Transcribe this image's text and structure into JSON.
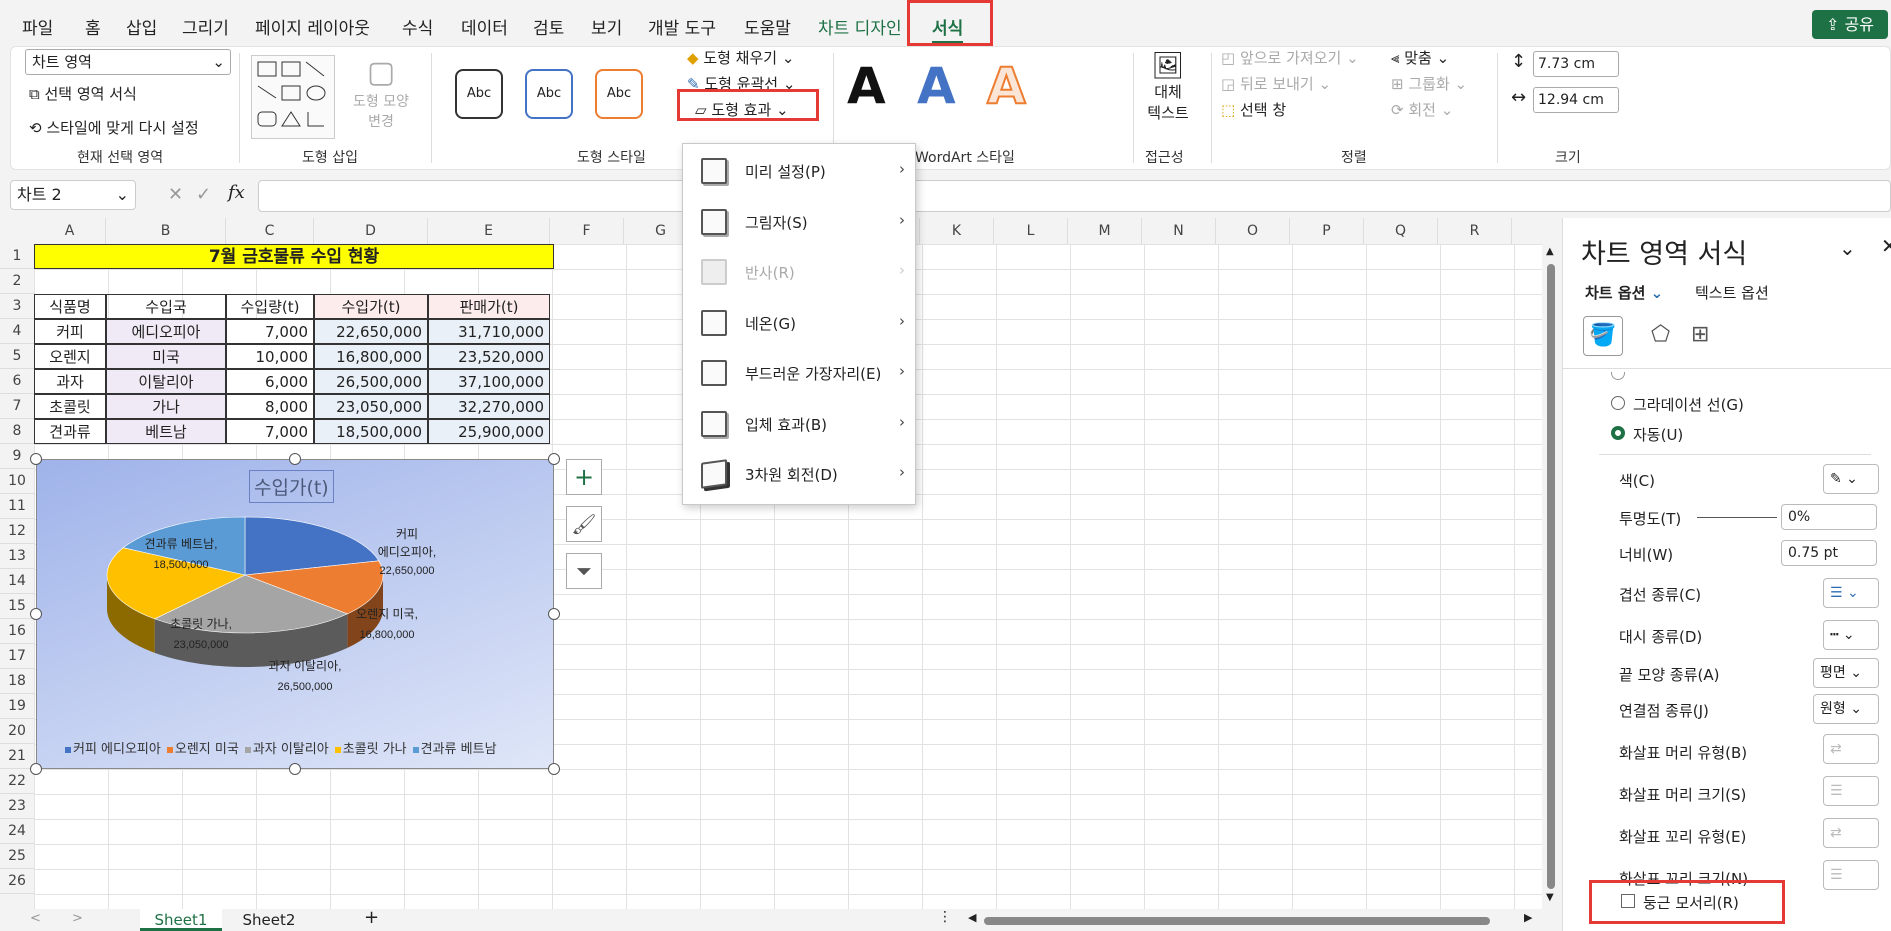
{
  "menu": [
    "파일",
    "홈",
    "삽입",
    "그리기",
    "페이지 레이아웃",
    "수식",
    "데이터",
    "검토",
    "보기",
    "개발 도구",
    "도움말",
    "차트 디자인",
    "서식"
  ],
  "share": "공유",
  "ribbon": {
    "selection_dropdown": "차트 영역",
    "format_selection": "선택 영역 서식",
    "reset_style": "스타일에 맞게 다시 설정",
    "grp_current": "현재 선택 영역",
    "change_shape": "도형 모양 변경",
    "grp_insert": "도형 삽입",
    "abc": "Abc",
    "shape_fill": "도형 채우기",
    "shape_outline": "도형 윤곽선",
    "shape_effects": "도형 효과",
    "grp_style": "도형 스타일",
    "wordart_letter": "A",
    "grp_wordart": "WordArt 스타일",
    "alt_text": "대체 텍스트",
    "grp_access": "접근성",
    "bring_forward": "앞으로 가져오기",
    "send_backward": "뒤로 보내기",
    "selection_pane": "선택 창",
    "align": "맞춤",
    "group": "그룹화",
    "rotate": "회전",
    "grp_arrange": "정렬",
    "height": "7.73 cm",
    "width": "12.94 cm",
    "grp_size": "크기"
  },
  "formula": {
    "namebox": "차트 2",
    "fx": "fx"
  },
  "columns": [
    "A",
    "B",
    "C",
    "D",
    "E",
    "F",
    "G",
    "H",
    "I",
    "J",
    "K",
    "L",
    "M",
    "N",
    "O",
    "P",
    "Q",
    "R"
  ],
  "rows": [
    "1",
    "2",
    "3",
    "4",
    "5",
    "6",
    "7",
    "8",
    "9",
    "10",
    "11",
    "12",
    "13",
    "14",
    "15",
    "16",
    "17",
    "18",
    "19",
    "20",
    "21",
    "22",
    "23",
    "24",
    "25",
    "26"
  ],
  "sheet": {
    "title": "7월 금호물류 수입 현황",
    "headers": [
      "식품명",
      "수입국",
      "수입량(t)",
      "수입가(t)",
      "판매가(t)"
    ],
    "data": [
      [
        "커피",
        "에디오피아",
        "7,000",
        "22,650,000",
        "31,710,000"
      ],
      [
        "오렌지",
        "미국",
        "10,000",
        "16,800,000",
        "23,520,000"
      ],
      [
        "과자",
        "이탈리아",
        "6,000",
        "26,500,000",
        "37,100,000"
      ],
      [
        "초콜릿",
        "가나",
        "8,000",
        "23,050,000",
        "32,270,000"
      ],
      [
        "견과류",
        "베트남",
        "7,000",
        "18,500,000",
        "25,900,000"
      ]
    ]
  },
  "chart_data": {
    "type": "pie",
    "title": "수입가(t)",
    "categories": [
      "커피 에디오피아",
      "오렌지 미국",
      "과자 이탈리아",
      "초콜릿 가나",
      "견과류 베트남"
    ],
    "values": [
      22650000,
      16800000,
      26500000,
      23050000,
      18500000
    ],
    "labels": [
      [
        "커피",
        "에디오피아,",
        "22,650,000"
      ],
      [
        "오렌지 미국,",
        "16,800,000"
      ],
      [
        "과자 이탈리아,",
        "26,500,000"
      ],
      [
        "초콜릿 가나,",
        "23,050,000"
      ],
      [
        "견과류 베트남,",
        "18,500,000"
      ]
    ],
    "colors": [
      "#4472c4",
      "#ed7d31",
      "#a5a5a5",
      "#ffc000",
      "#5b9bd5"
    ],
    "legend": "bottom"
  },
  "effects_menu": [
    "미리 설정(P)",
    "그림자(S)",
    "반사(R)",
    "네온(G)",
    "부드러운 가장자리(E)",
    "입체 효과(B)",
    "3차원 회전(D)"
  ],
  "pane": {
    "title": "차트 영역 서식",
    "tab1": "차트 옵션",
    "tab2": "텍스트 옵션",
    "gradient_line": "그라데이션 선(G)",
    "auto": "자동(U)",
    "color": "색(C)",
    "transparency": "투명도(T)",
    "transparency_val": "0%",
    "width": "너비(W)",
    "width_val": "0.75 pt",
    "compound": "겹선 종류(C)",
    "dash": "대시 종류(D)",
    "cap": "끝 모양 종류(A)",
    "cap_val": "평면",
    "join": "연결점 종류(J)",
    "join_val": "원형",
    "arrow_begin_type": "화살표 머리 유형(B)",
    "arrow_begin_size": "화살표 머리 크기(S)",
    "arrow_end_type": "화살표 꼬리 유형(E)",
    "arrow_end_size": "화살표 꼬리 크기(N)",
    "rounded": "둥근 모서리(R)"
  },
  "sheets": [
    "Sheet1",
    "Sheet2"
  ]
}
